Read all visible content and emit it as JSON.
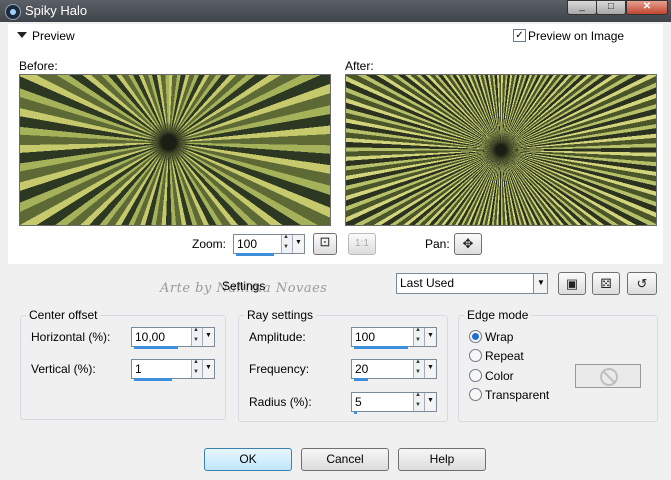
{
  "window": {
    "title": "Spiky Halo"
  },
  "preview": {
    "toggle_label": "Preview",
    "preview_on_image_label": "Preview on Image",
    "preview_on_image_checked": true,
    "before_label": "Before:",
    "after_label": "After:",
    "zoom_label": "Zoom:",
    "zoom_value": "100",
    "pan_label": "Pan:"
  },
  "settings": {
    "label": "Settings",
    "preset_value": "Last Used",
    "watermark_text": "Arte by Nahima Novaes"
  },
  "center_offset": {
    "title": "Center offset",
    "horizontal_label": "Horizontal (%):",
    "horizontal_value": "10,00",
    "vertical_label": "Vertical (%):",
    "vertical_value": "1"
  },
  "ray_settings": {
    "title": "Ray settings",
    "amplitude_label": "Amplitude:",
    "amplitude_value": "100",
    "frequency_label": "Frequency:",
    "frequency_value": "20",
    "radius_label": "Radius (%):",
    "radius_value": "5"
  },
  "edge_mode": {
    "title": "Edge mode",
    "options": [
      "Wrap",
      "Repeat",
      "Color",
      "Transparent"
    ],
    "selected": "Wrap"
  },
  "buttons": {
    "ok": "OK",
    "cancel": "Cancel",
    "help": "Help"
  },
  "colors": {
    "accent": "#3d8fdc",
    "title_bar": "#4a5057"
  }
}
